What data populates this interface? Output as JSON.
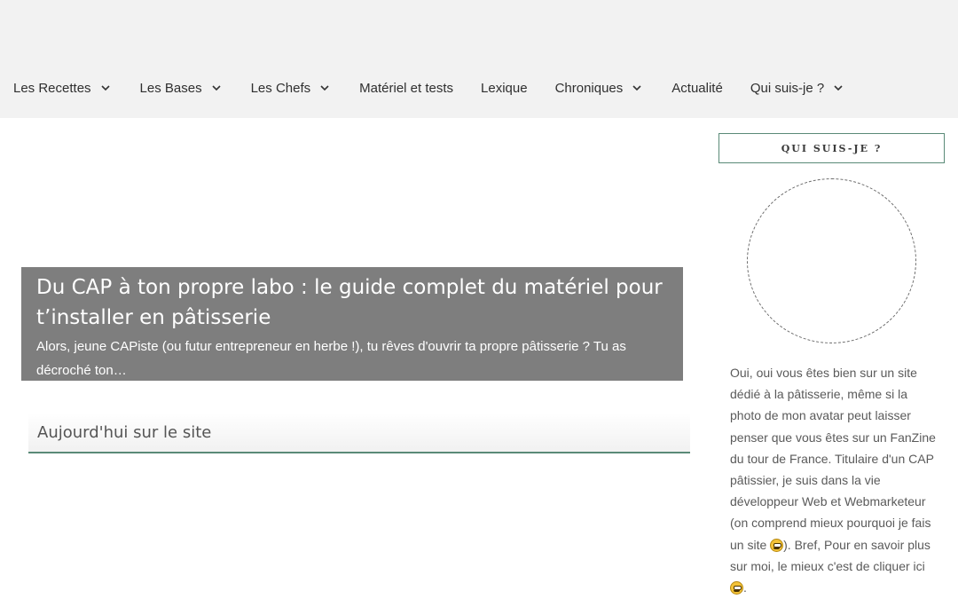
{
  "nav": {
    "items": [
      {
        "label": "Les Recettes",
        "has_dropdown": true
      },
      {
        "label": "Les Bases",
        "has_dropdown": true
      },
      {
        "label": "Les Chefs",
        "has_dropdown": true
      },
      {
        "label": "Matériel et tests",
        "has_dropdown": false
      },
      {
        "label": "Lexique",
        "has_dropdown": false
      },
      {
        "label": "Chroniques",
        "has_dropdown": true
      },
      {
        "label": "Actualité",
        "has_dropdown": false
      },
      {
        "label": "Qui suis-je ?",
        "has_dropdown": true
      }
    ]
  },
  "hero": {
    "title": "Du CAP à ton propre labo : le guide complet du matériel pour t’installer en pâtisserie",
    "excerpt": "Alors, jeune CAPiste (ou futur entrepreneur en herbe !), tu rêves d'ouvrir ta propre pâtisserie ? Tu as décroché ton…"
  },
  "section": {
    "title": "Aujourd'hui sur le site"
  },
  "sidebar": {
    "widget_title": "QUI SUIS-JE ?",
    "bio_part1": "Oui, oui vous êtes bien sur un site dédié à la pâtisserie, même si la photo de mon avatar peut laisser penser que vous êtes sur un FanZine du tour de France. Titulaire d'un CAP pâtissier, je suis dans la vie développeur Web et Webmarketeur (on comprend mieux pourquoi je fais un site ",
    "bio_part2": "). Bref, Pour en savoir plus sur moi, le mieux c'est de cliquer ici ",
    "bio_part3": ".",
    "emoji_icon": "grinning-face-emoji"
  },
  "colors": {
    "accent": "#5a8a77",
    "hero_bg": "#7e7e7e",
    "topbar_bg": "#f2f2f2"
  }
}
